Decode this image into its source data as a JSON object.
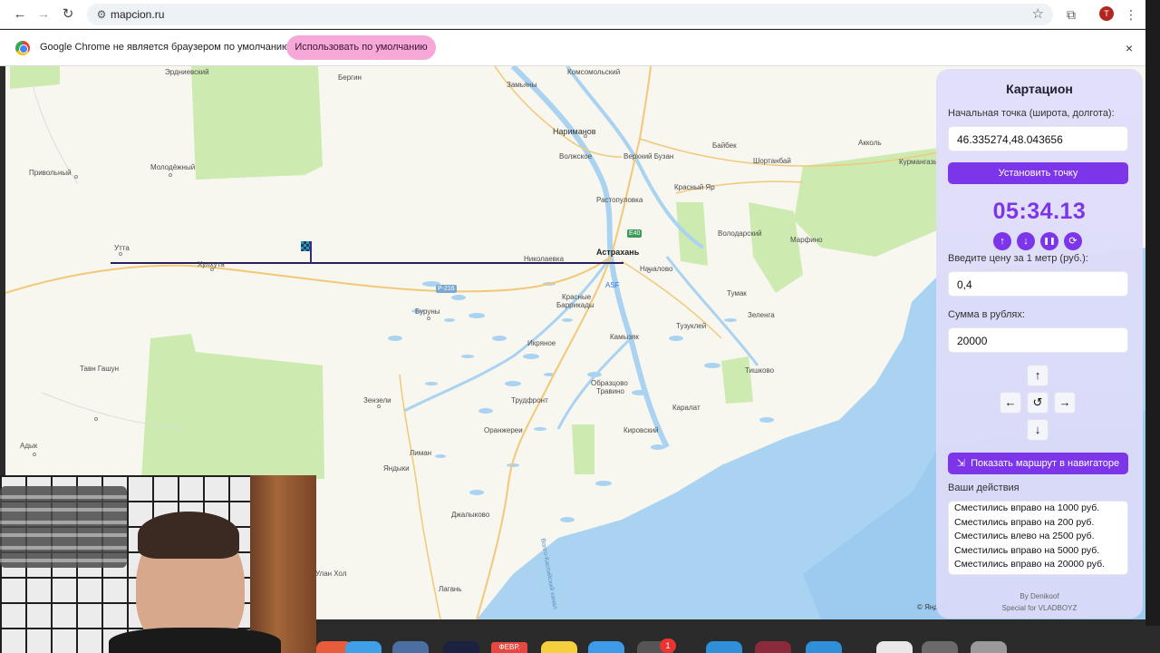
{
  "browser": {
    "url": "mapcion.ru",
    "profile_initial": "T",
    "icons": [
      "back-arrow-icon",
      "forward-arrow-icon",
      "reload-icon",
      "site-settings-icon",
      "bookmark-star-icon",
      "extensions-icon",
      "menu-dots-icon"
    ]
  },
  "infobar": {
    "message": "Google Chrome не является браузером по умолчанию.",
    "button_label": "Использовать по умолчанию",
    "close": "×"
  },
  "map": {
    "labels": {
      "erdnievsky": "Эрдниевский",
      "bergin": "Бергин",
      "komsomolsky": "Комсомольский",
      "zamyany": "Замьяны",
      "narimanov": "Нариманов",
      "volzhskoe": "Волжское",
      "verkhniy_buzan": "Верхний Бузан",
      "baykek": "Байбек",
      "akkol": "Акколь",
      "shortanbay": "Шортанбай",
      "kurmangazy": "Курмангазы",
      "privolny": "Привольный",
      "molodezhny": "Молодёжный",
      "krasny_yar": "Красный Яр",
      "rastopulovka": "Растопуловка",
      "volodarsky": "Володарский",
      "marfino": "Марфино",
      "utta": "Утта",
      "khulkhuta": "Хулхута",
      "nikolaevka": "Николаевка",
      "astrakhan": "Астрахань",
      "nachalovo": "Началово",
      "asf": "ASF",
      "r216": "Р-216",
      "e40": "E40",
      "krasnye_barrikady_1": "Красные",
      "krasnye_barrikady_2": "Баррикады",
      "tumak": "Тумак",
      "zelenga": "Зеленга",
      "buruny": "Буруны",
      "tuzukley": "Тузуклей",
      "ikryanoe": "Икряное",
      "kamyzyak": "Камызяк",
      "tavn_gashun": "Тавн Гашун",
      "tishkovo": "Тишково",
      "obrazcovo_1": "Образцово",
      "obrazcovo_2": "Травино",
      "zenzeli": "Зензели",
      "trudfront": "Трудфронт",
      "karalat": "Каралат",
      "kirovsky": "Кировский",
      "orangerei": "Оранжереи",
      "adyk": "Адык",
      "liman": "Лиман",
      "yandyki": "Яндыки",
      "dzhalykovo": "Джалыково",
      "ulan_khol": "Улан Хол",
      "lagan": "Лагань",
      "volgo_caspian": "Волго-Каспийский канал"
    },
    "copyright": "© Яндекс"
  },
  "panel": {
    "title": "Картацион",
    "start_point_label": "Начальная точка (широта, долгота):",
    "start_point_value": "46.335274,48.043656",
    "set_point_button": "Установить точку",
    "timer": "05:34.13",
    "price_label": "Введите цену за 1 метр (руб.):",
    "price_value": "0,4",
    "sum_label": "Сумма в рублях:",
    "sum_value": "20000",
    "arrows": {
      "up": "↑",
      "left": "←",
      "reset": "↺",
      "right": "→",
      "down": "↓"
    },
    "timer_controls": {
      "up": "↑",
      "down": "↓",
      "pause": "❚❚",
      "refresh": "⟳"
    },
    "navigator_button": "Показать маршрут в навигаторе",
    "actions_label": "Ваши действия",
    "actions": [
      "Сместились вправо на 1000 руб.",
      "Сместились вправо на 200 руб.",
      "Сместились влево на 2500 руб.",
      "Сместились вправо на 5000 руб.",
      "Сместились вправо на 20000 руб."
    ],
    "credit_by": "By Denikoof",
    "credit_special": "Special for VLADBOYZ"
  },
  "dock": {
    "calendar_month": "ФЕВР.",
    "badge_count": "1"
  },
  "colors": {
    "accent": "#7c35e8",
    "infobar_button": "#f6a8d9",
    "water": "#aad3f2",
    "green": "#cdebb0",
    "route_line": "#2b1f5e"
  }
}
